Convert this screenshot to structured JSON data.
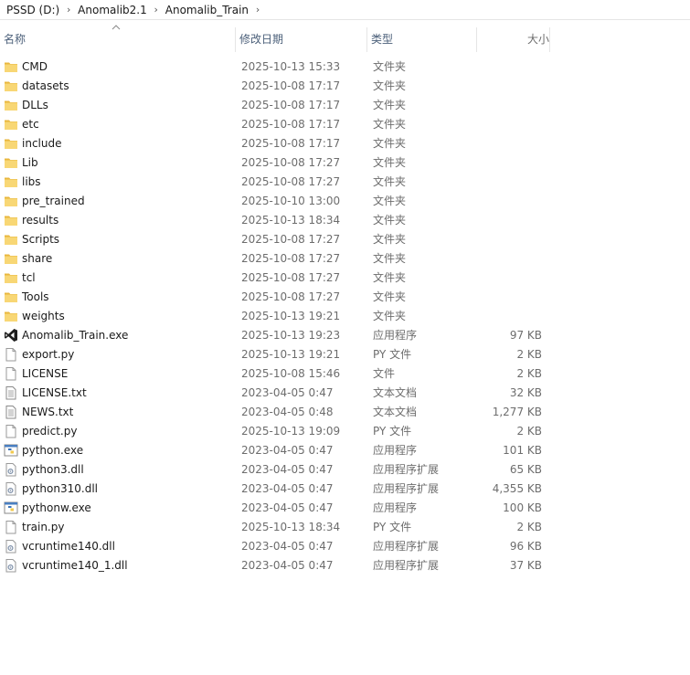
{
  "breadcrumb": [
    "PSSD (D:)",
    "Anomalib2.1",
    "Anomalib_Train"
  ],
  "columns": {
    "name": "名称",
    "date": "修改日期",
    "type": "类型",
    "size": "大小"
  },
  "sort": {
    "column": "name",
    "direction": "ascending"
  },
  "files": [
    {
      "name": "CMD",
      "date": "2025-10-13 15:33",
      "type": "文件夹",
      "size": "",
      "icon": "folder-icon"
    },
    {
      "name": "datasets",
      "date": "2025-10-08 17:17",
      "type": "文件夹",
      "size": "",
      "icon": "folder-icon"
    },
    {
      "name": "DLLs",
      "date": "2025-10-08 17:17",
      "type": "文件夹",
      "size": "",
      "icon": "folder-icon"
    },
    {
      "name": "etc",
      "date": "2025-10-08 17:17",
      "type": "文件夹",
      "size": "",
      "icon": "folder-icon"
    },
    {
      "name": "include",
      "date": "2025-10-08 17:17",
      "type": "文件夹",
      "size": "",
      "icon": "folder-icon"
    },
    {
      "name": "Lib",
      "date": "2025-10-08 17:27",
      "type": "文件夹",
      "size": "",
      "icon": "folder-icon"
    },
    {
      "name": "libs",
      "date": "2025-10-08 17:27",
      "type": "文件夹",
      "size": "",
      "icon": "folder-icon"
    },
    {
      "name": "pre_trained",
      "date": "2025-10-10 13:00",
      "type": "文件夹",
      "size": "",
      "icon": "folder-icon"
    },
    {
      "name": "results",
      "date": "2025-10-13 18:34",
      "type": "文件夹",
      "size": "",
      "icon": "folder-icon"
    },
    {
      "name": "Scripts",
      "date": "2025-10-08 17:27",
      "type": "文件夹",
      "size": "",
      "icon": "folder-icon"
    },
    {
      "name": "share",
      "date": "2025-10-08 17:27",
      "type": "文件夹",
      "size": "",
      "icon": "folder-icon"
    },
    {
      "name": "tcl",
      "date": "2025-10-08 17:27",
      "type": "文件夹",
      "size": "",
      "icon": "folder-icon"
    },
    {
      "name": "Tools",
      "date": "2025-10-08 17:27",
      "type": "文件夹",
      "size": "",
      "icon": "folder-icon"
    },
    {
      "name": "weights",
      "date": "2025-10-13 19:21",
      "type": "文件夹",
      "size": "",
      "icon": "folder-icon"
    },
    {
      "name": "Anomalib_Train.exe",
      "date": "2025-10-13 19:23",
      "type": "应用程序",
      "size": "97 KB",
      "icon": "visual-studio-icon"
    },
    {
      "name": "export.py",
      "date": "2025-10-13 19:21",
      "type": "PY 文件",
      "size": "2 KB",
      "icon": "py-file-icon"
    },
    {
      "name": "LICENSE",
      "date": "2025-10-08 15:46",
      "type": "文件",
      "size": "2 KB",
      "icon": "blank-file-icon"
    },
    {
      "name": "LICENSE.txt",
      "date": "2023-04-05 0:47",
      "type": "文本文档",
      "size": "32 KB",
      "icon": "text-file-icon"
    },
    {
      "name": "NEWS.txt",
      "date": "2023-04-05 0:48",
      "type": "文本文档",
      "size": "1,277 KB",
      "icon": "text-file-icon"
    },
    {
      "name": "predict.py",
      "date": "2025-10-13 19:09",
      "type": "PY 文件",
      "size": "2 KB",
      "icon": "py-file-icon"
    },
    {
      "name": "python.exe",
      "date": "2023-04-05 0:47",
      "type": "应用程序",
      "size": "101 KB",
      "icon": "python-exe-icon"
    },
    {
      "name": "python3.dll",
      "date": "2023-04-05 0:47",
      "type": "应用程序扩展",
      "size": "65 KB",
      "icon": "dll-file-icon"
    },
    {
      "name": "python310.dll",
      "date": "2023-04-05 0:47",
      "type": "应用程序扩展",
      "size": "4,355 KB",
      "icon": "dll-file-icon"
    },
    {
      "name": "pythonw.exe",
      "date": "2023-04-05 0:47",
      "type": "应用程序",
      "size": "100 KB",
      "icon": "python-exe-icon"
    },
    {
      "name": "train.py",
      "date": "2025-10-13 18:34",
      "type": "PY 文件",
      "size": "2 KB",
      "icon": "py-file-icon"
    },
    {
      "name": "vcruntime140.dll",
      "date": "2023-04-05 0:47",
      "type": "应用程序扩展",
      "size": "96 KB",
      "icon": "dll-file-icon"
    },
    {
      "name": "vcruntime140_1.dll",
      "date": "2023-04-05 0:47",
      "type": "应用程序扩展",
      "size": "37 KB",
      "icon": "dll-file-icon"
    }
  ],
  "colors": {
    "header_text": "#4c607a",
    "folder": "#f8d775",
    "folder_back": "#e9b73e",
    "vs_purple": "#1e1e1e"
  }
}
